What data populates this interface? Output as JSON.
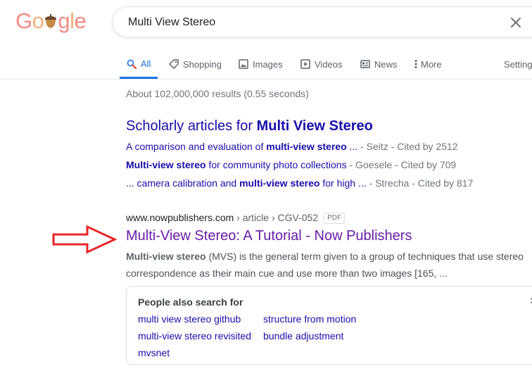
{
  "logo": {
    "letters": [
      "G",
      "o",
      "o",
      "g",
      "l",
      "e"
    ],
    "colors": [
      "#f28b82",
      "#f6ad7b",
      "#fbbc04",
      "#f28b82",
      "#f6ad7b",
      "#f28b82"
    ]
  },
  "search": {
    "value": "Multi View Stereo",
    "clear_icon": "close-icon"
  },
  "tabs": [
    {
      "label": "All",
      "icon": "search-icon",
      "active": true
    },
    {
      "label": "Shopping",
      "icon": "tag-icon"
    },
    {
      "label": "Images",
      "icon": "image-icon"
    },
    {
      "label": "Videos",
      "icon": "play-icon"
    },
    {
      "label": "News",
      "icon": "news-icon"
    },
    {
      "label": "More",
      "icon": "more-vert-icon"
    },
    {
      "label": "Settings"
    }
  ],
  "stats": "About 102,000,000 results (0.55 seconds)",
  "scholar": {
    "title_prefix": "Scholarly articles for ",
    "title_bold": "Multi View Stereo",
    "rows": [
      {
        "pre": "A comparison and evaluation of ",
        "bold": "multi-view stereo",
        "post": " ...",
        "meta": " - Seitz - Cited by 2512"
      },
      {
        "pre": "",
        "bold": "Multi-view stereo",
        "post": " for community photo collections",
        "meta": " - Goesele - Cited by 709"
      },
      {
        "pre": "... camera calibration and ",
        "bold": "multi-view stereo",
        "post": " for high ...",
        "meta": " - Strecha - Cited by 817"
      }
    ]
  },
  "result": {
    "domain": "www.nowpublishers.com",
    "path": " › article › CGV-052",
    "badge": "PDF",
    "title": "Multi-View Stereo: A Tutorial - Now Publishers",
    "snippet_bold": "Multi-view stereo",
    "snippet_rest": " (MVS) is the general term given to a group of techniques that use stereo correspondence as their main cue and use more than two images [165, ..."
  },
  "people_also_search": {
    "title": "People also search for",
    "links": [
      "multi view stereo github",
      "structure from motion",
      "multi-view stereo revisited",
      "bundle adjustment",
      "mvsnet"
    ],
    "close": "✕"
  },
  "colors": {
    "link": "#1a0dab",
    "visited": "#681da8",
    "accent": "#1a73e8",
    "arrow": "#e8262a"
  }
}
